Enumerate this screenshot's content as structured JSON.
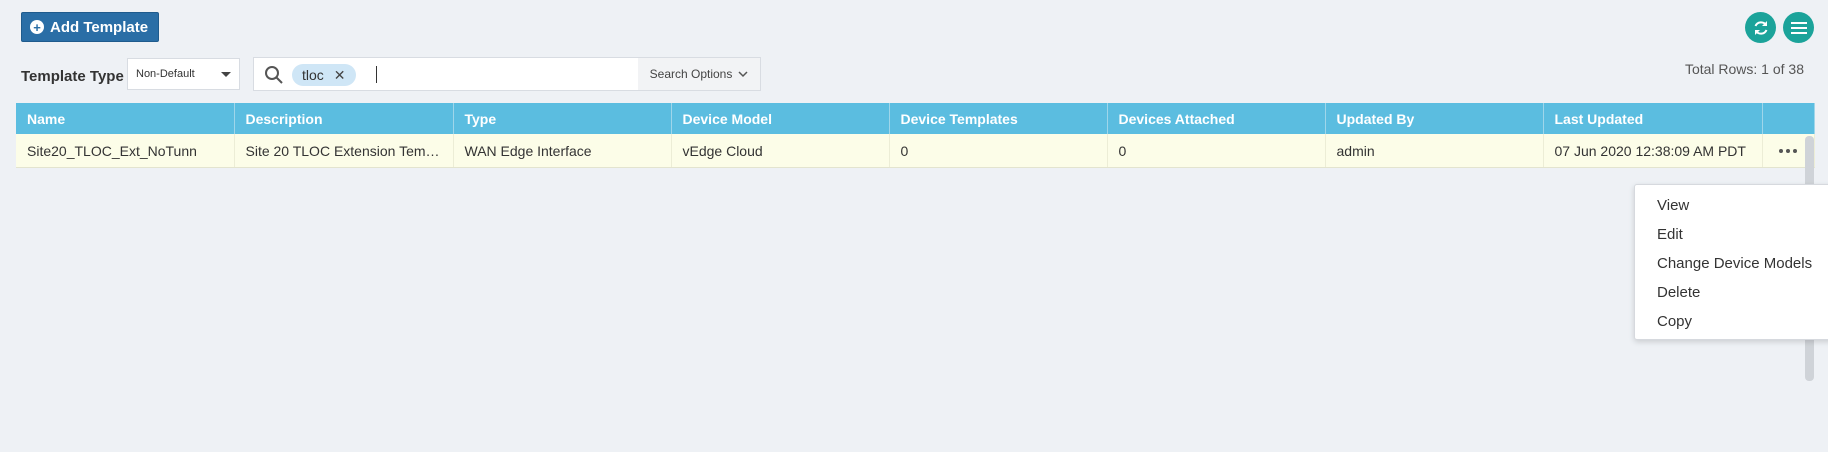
{
  "toolbar": {
    "add_template_label": "Add Template",
    "refresh_icon": "refresh-icon",
    "menu_icon": "hamburger-menu-icon",
    "accent_color": "#1ba39a",
    "button_color": "#2a6ea6"
  },
  "filters": {
    "template_type_label": "Template Type",
    "template_type_value": "Non-Default",
    "search_chip": "tloc",
    "search_options_label": "Search Options",
    "total_rows": "Total Rows: 1 of 38"
  },
  "table": {
    "header_color": "#5bbde0",
    "columns": [
      "Name",
      "Description",
      "Type",
      "Device Model",
      "Device Templates",
      "Devices Attached",
      "Updated By",
      "Last Updated"
    ],
    "rows": [
      [
        "Site20_TLOC_Ext_NoTunn",
        "Site 20 TLOC Extension Templ...",
        "WAN Edge Interface",
        "vEdge Cloud",
        "0",
        "0",
        "admin",
        "07 Jun 2020 12:38:09 AM PDT"
      ]
    ]
  },
  "context_menu": {
    "items": [
      "View",
      "Edit",
      "Change Device Models",
      "Delete",
      "Copy"
    ]
  }
}
